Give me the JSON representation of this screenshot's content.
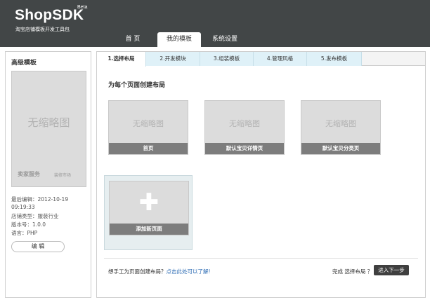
{
  "header": {
    "logo": "ShopSDK",
    "beta": "Beta",
    "subtitle": "淘宝店铺模板开发工具包",
    "nav": [
      {
        "label": "首 页"
      },
      {
        "label": "我的模板"
      },
      {
        "label": "系统设置"
      }
    ],
    "active_nav": "我的模板"
  },
  "sidebar": {
    "title": "高级模板",
    "thumb_text": "无缩略图",
    "thumb_brand": "卖家服务",
    "thumb_brand_small": "装修市场",
    "meta": {
      "last_edit_label": "最后编辑：2012-10-19",
      "last_edit_time": "09:19:33",
      "shop_type": "店铺类型：服装行业",
      "version": "版本号：1.0.0",
      "language": "语言：PHP"
    },
    "edit_button": "编 辑"
  },
  "steps": [
    {
      "label": "1.选择布局"
    },
    {
      "label": "2.开发模块"
    },
    {
      "label": "3.组装模板"
    },
    {
      "label": "4.管理风格"
    },
    {
      "label": "5.发布模板"
    }
  ],
  "active_step": "1.选择布局",
  "main": {
    "section_title": "为每个页面创建布局",
    "layouts": [
      {
        "thumb_text": "无缩略图",
        "caption": "首页"
      },
      {
        "thumb_text": "无缩略图",
        "caption": "默认宝贝详情页"
      },
      {
        "thumb_text": "无缩略图",
        "caption": "默认宝贝分类页"
      }
    ],
    "add_page": {
      "icon": "plus-icon",
      "caption": "添加新页面"
    },
    "help_text": "想手工为页面创建布局？",
    "help_link": "点击此处可以了解!",
    "done_text": "完成 选择布局 ？",
    "next_button": "进入下一步"
  }
}
